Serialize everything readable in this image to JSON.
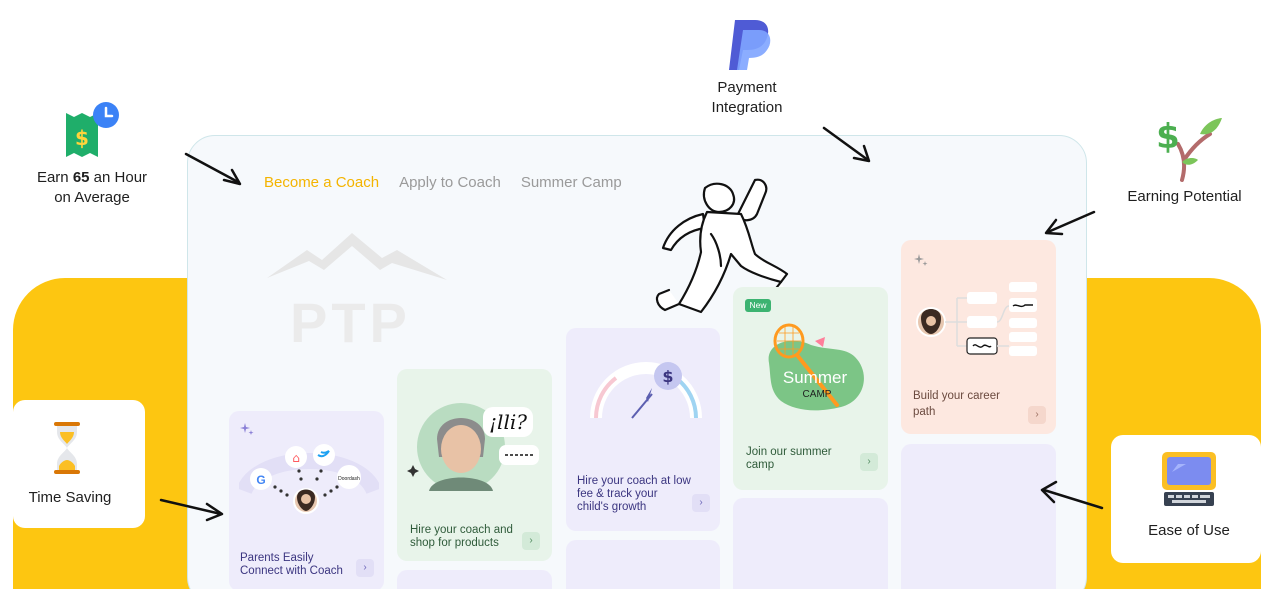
{
  "nav": {
    "items": [
      {
        "label": "Become a Coach",
        "active": true
      },
      {
        "label": "Apply to Coach",
        "active": false
      },
      {
        "label": "Summer Camp",
        "active": false
      }
    ]
  },
  "logo": {
    "text": "PTP"
  },
  "features": {
    "earn": {
      "prefix": "Earn ",
      "amount": "65",
      "suffix": " an Hour",
      "line2": "on Average"
    },
    "payment": {
      "line1": "Payment",
      "line2": "Integration"
    },
    "earning": {
      "label": "Earning Potential"
    },
    "time": {
      "label": "Time Saving"
    },
    "ease": {
      "label": "Ease of Use"
    }
  },
  "cards": {
    "connect": {
      "line1": "Parents Easily",
      "line2": "Connect with Coach"
    },
    "shop": {
      "line1": "Hire your coach and",
      "line2": "shop for products"
    },
    "hire_fee": {
      "line1": "Hire your coach at low",
      "line2": "fee & track your",
      "line3": "child's growth"
    },
    "camp": {
      "badge": "New",
      "title": "Summer",
      "subtitle": "CAMP",
      "line1": "Join our summer",
      "line2": "camp"
    },
    "career": {
      "line1": "Build your career",
      "line2": "path"
    }
  },
  "colors": {
    "yellow": "#fdc611",
    "nav_active": "#f4b400",
    "paypal_dark": "#253b80",
    "paypal_light": "#179bd7",
    "green_badge": "#3cb371"
  }
}
